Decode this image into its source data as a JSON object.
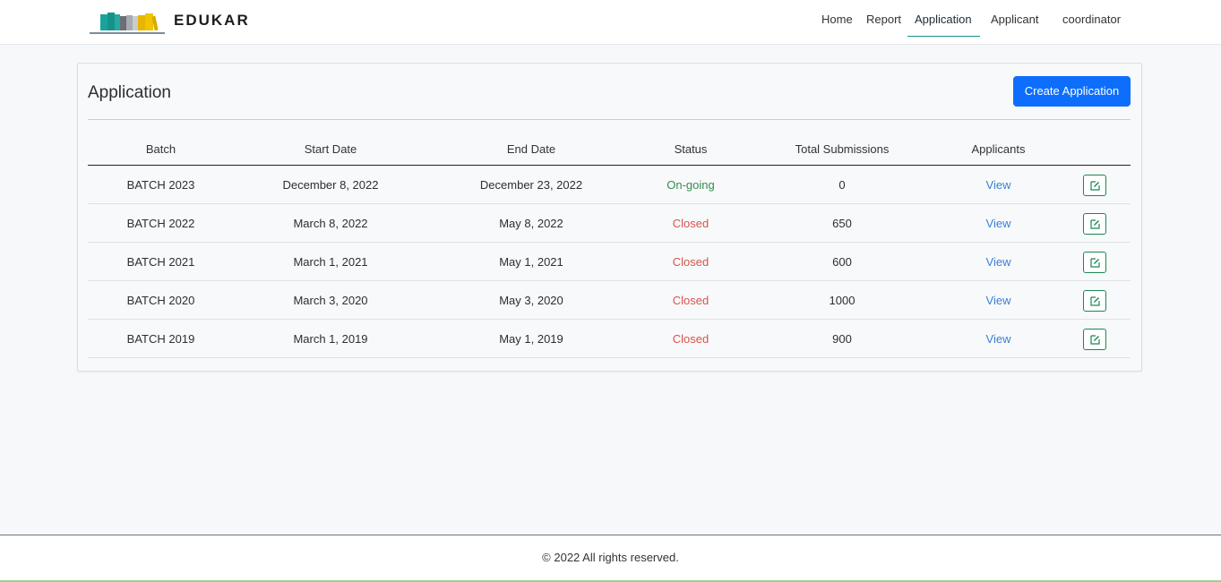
{
  "brand": {
    "name": "EDUKAR"
  },
  "nav": {
    "items": [
      {
        "label": "Home"
      },
      {
        "label": "Report"
      },
      {
        "label": "Application"
      },
      {
        "label": "Applicant"
      },
      {
        "label": "coordinator"
      }
    ],
    "active": "Application"
  },
  "page": {
    "title": "Application",
    "create_label": "Create Application"
  },
  "table": {
    "headers": [
      "Batch",
      "Start Date",
      "End Date",
      "Status",
      "Total Submissions",
      "Applicants",
      ""
    ],
    "rows": [
      {
        "batch": "BATCH 2023",
        "start": "December 8, 2022",
        "end": "December 23, 2022",
        "status": "On-going",
        "total": "0",
        "applicants": "View"
      },
      {
        "batch": "BATCH 2022",
        "start": "March 8, 2022",
        "end": "May 8, 2022",
        "status": "Closed",
        "total": "650",
        "applicants": "View"
      },
      {
        "batch": "BATCH 2021",
        "start": "March 1, 2021",
        "end": "May 1, 2021",
        "status": "Closed",
        "total": "600",
        "applicants": "View"
      },
      {
        "batch": "BATCH 2020",
        "start": "March 3, 2020",
        "end": "May 3, 2020",
        "status": "Closed",
        "total": "1000",
        "applicants": "View"
      },
      {
        "batch": "BATCH 2019",
        "start": "March 1, 2019",
        "end": "May 1, 2019",
        "status": "Closed",
        "total": "900",
        "applicants": "View"
      }
    ]
  },
  "colors": {
    "primary": "#0d6efd",
    "ongoing": "#3a8a52",
    "closed": "#d9534f",
    "link": "#3c7fd6",
    "edit_border": "#198754"
  },
  "icons": {
    "edit": "edit-icon",
    "logo": "books-logo-icon"
  },
  "footer": {
    "text": "© 2022 All rights reserved."
  }
}
